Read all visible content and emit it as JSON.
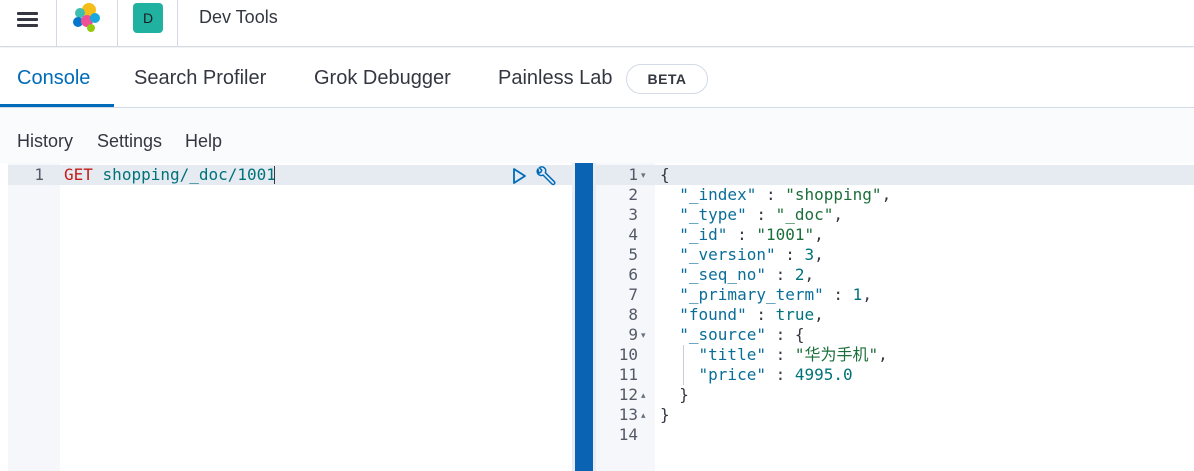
{
  "header": {
    "app_title": "Dev Tools",
    "space_initial": "D",
    "space_color": "#20b1a1"
  },
  "tabs": [
    {
      "label": "Console",
      "active": true
    },
    {
      "label": "Search Profiler",
      "active": false
    },
    {
      "label": "Grok Debugger",
      "active": false
    },
    {
      "label": "Painless Lab",
      "active": false
    }
  ],
  "beta_badge": "BETA",
  "subnav": {
    "history": "History",
    "settings": "Settings",
    "help": "Help"
  },
  "request_editor": {
    "line_number": "1",
    "method": "GET",
    "url": "shopping/_doc/1001",
    "actions": [
      "play-icon",
      "wrench-icon"
    ]
  },
  "response_editor": {
    "line_numbers": [
      "1",
      "2",
      "3",
      "4",
      "5",
      "6",
      "7",
      "8",
      "9",
      "10",
      "11",
      "12",
      "13",
      "14"
    ],
    "lines": [
      "{",
      "  \"_index\" : \"shopping\",",
      "  \"_type\" : \"_doc\",",
      "  \"_id\" : \"1001\",",
      "  \"_version\" : 3,",
      "  \"_seq_no\" : 2,",
      "  \"_primary_term\" : 1,",
      "  \"found\" : true,",
      "  \"_source\" : {",
      "    \"title\" : \"华为手机\",",
      "    \"price\" : 4995.0",
      "  }",
      "}",
      ""
    ]
  },
  "colors": {
    "accent": "#006bb8",
    "divider": "#0b64b3",
    "method": "#c41a16",
    "url": "#00727a"
  }
}
